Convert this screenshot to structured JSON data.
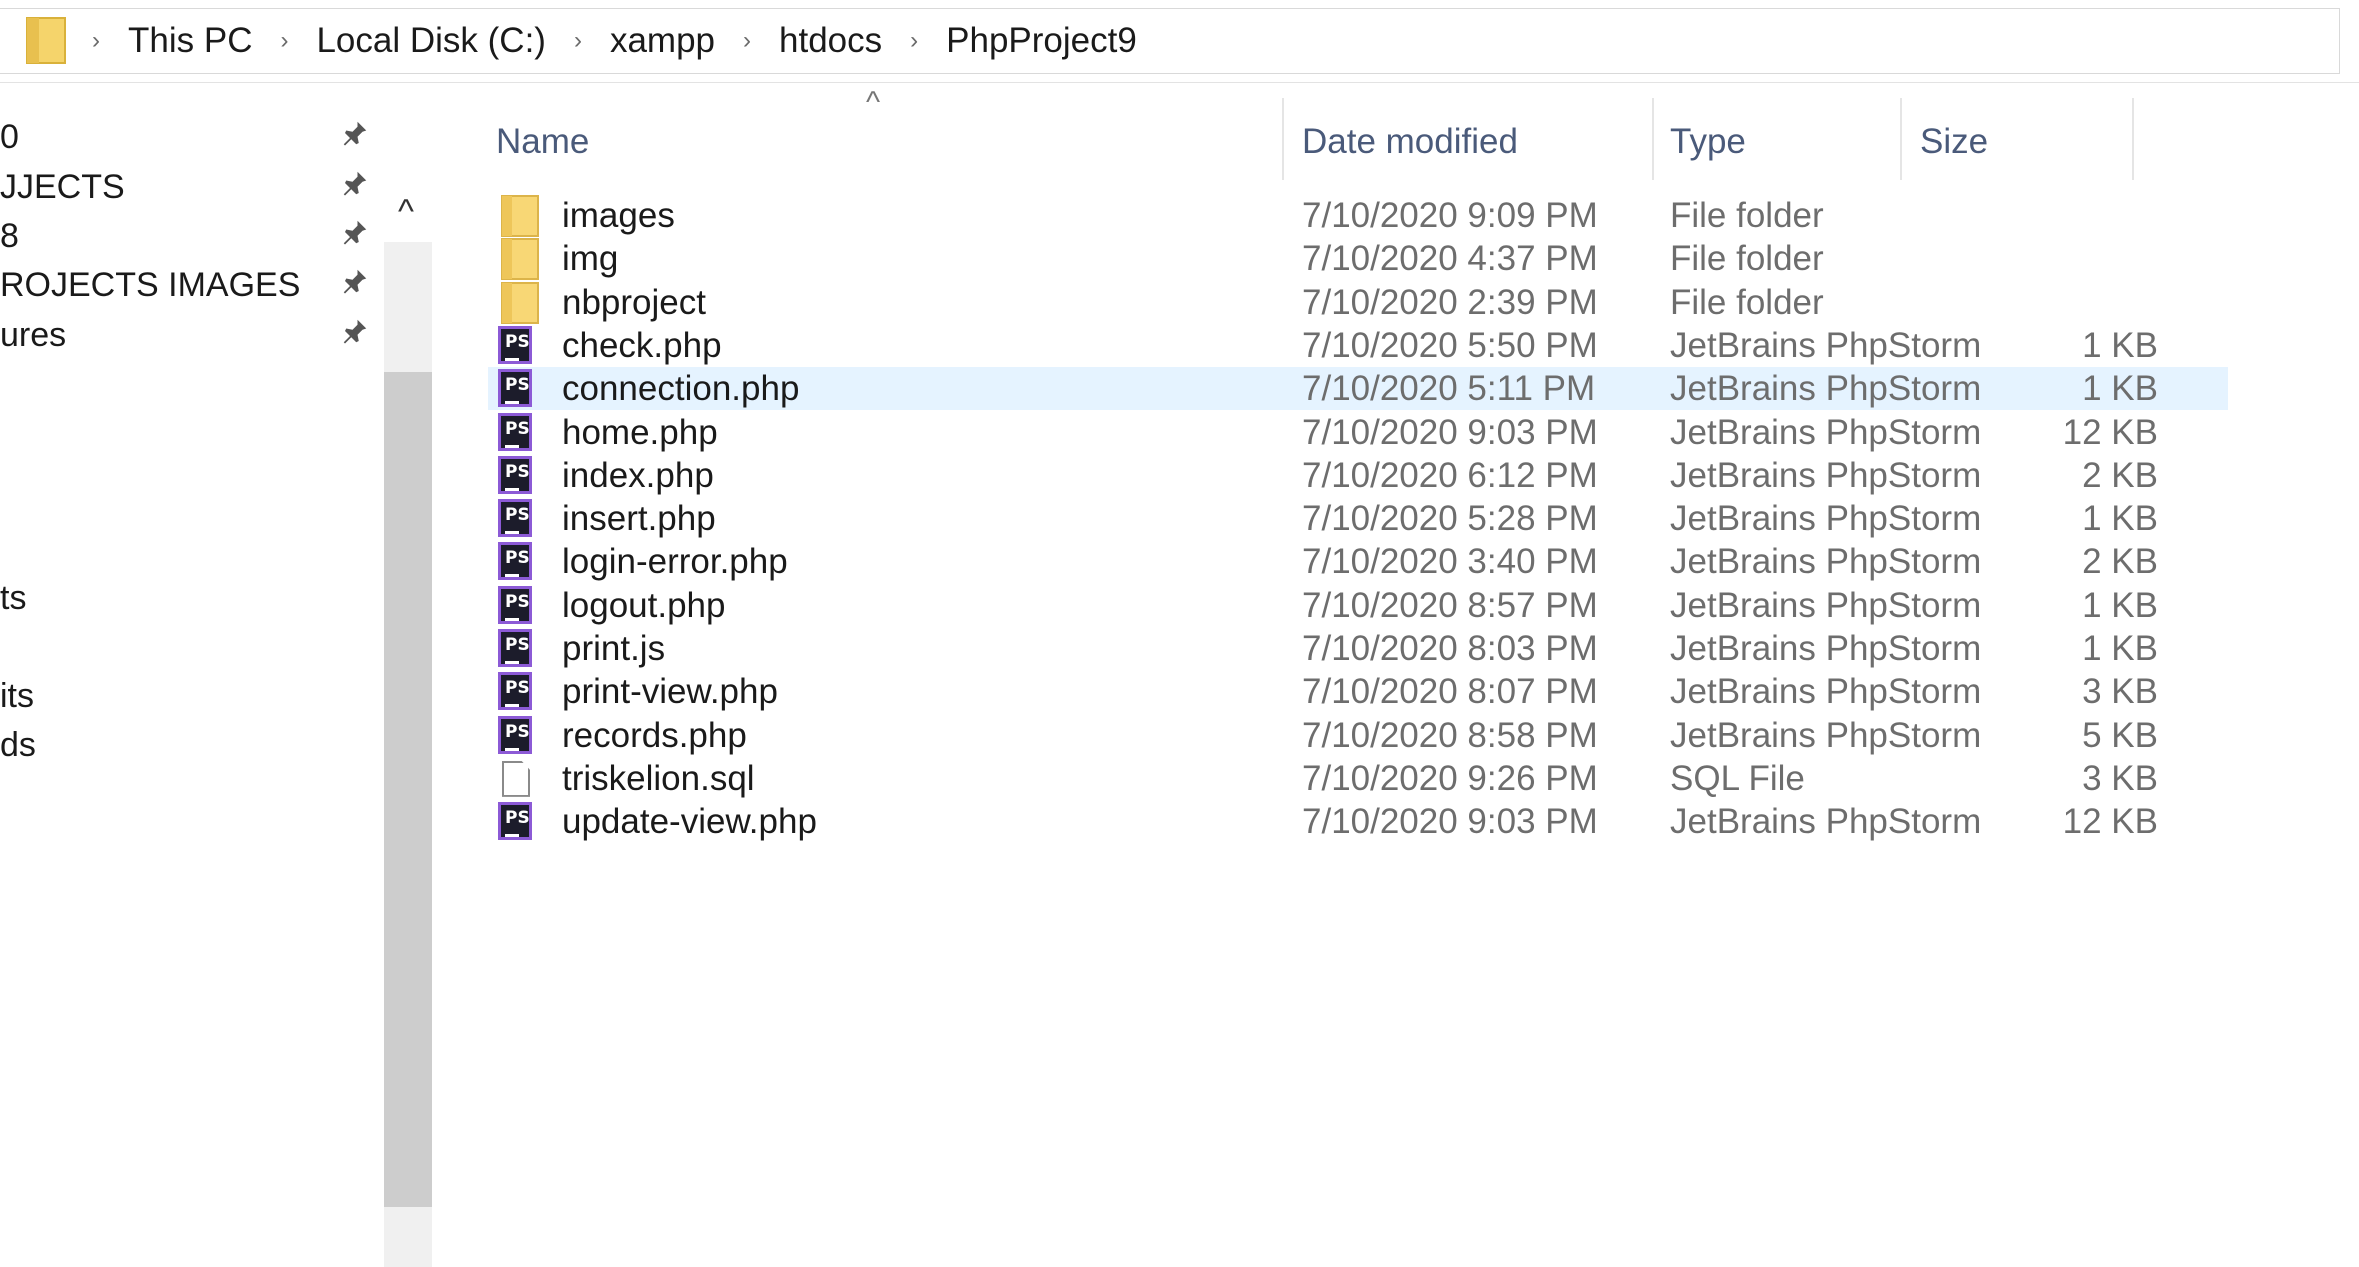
{
  "address_bar": {
    "crumbs": [
      "This PC",
      "Local Disk (C:)",
      "xampp",
      "htdocs",
      "PhpProject9"
    ],
    "separator": "›"
  },
  "nav_pane": {
    "items": [
      {
        "label": "0",
        "pinned": true
      },
      {
        "label": "JJECTS",
        "pinned": true
      },
      {
        "label": "8",
        "pinned": true
      },
      {
        "label": "ROJECTS IMAGES",
        "pinned": true
      },
      {
        "label": "ures",
        "pinned": true
      },
      {
        "label": "ts",
        "pinned": false
      },
      {
        "label": "its",
        "pinned": false
      },
      {
        "label": "ds",
        "pinned": false
      }
    ],
    "pin_glyph": "📌",
    "scroll_up_glyph": "^"
  },
  "file_list": {
    "columns": {
      "name": "Name",
      "date": "Date modified",
      "type": "Type",
      "size": "Size"
    },
    "sort_caret": "^",
    "selected_color": "#e5f3ff",
    "rows": [
      {
        "name": "images",
        "date": "7/10/2020 9:09 PM",
        "type": "File folder",
        "size": "",
        "icon": "folder-icon"
      },
      {
        "name": "img",
        "date": "7/10/2020 4:37 PM",
        "type": "File folder",
        "size": "",
        "icon": "folder-icon"
      },
      {
        "name": "nbproject",
        "date": "7/10/2020 2:39 PM",
        "type": "File folder",
        "size": "",
        "icon": "folder-icon"
      },
      {
        "name": "check.php",
        "date": "7/10/2020 5:50 PM",
        "type": "JetBrains PhpStorm",
        "size": "1 KB",
        "icon": "phpstorm-icon"
      },
      {
        "name": "connection.php",
        "date": "7/10/2020 5:11 PM",
        "type": "JetBrains PhpStorm",
        "size": "1 KB",
        "icon": "phpstorm-icon",
        "selected": true
      },
      {
        "name": "home.php",
        "date": "7/10/2020 9:03 PM",
        "type": "JetBrains PhpStorm",
        "size": "12 KB",
        "icon": "phpstorm-icon"
      },
      {
        "name": "index.php",
        "date": "7/10/2020 6:12 PM",
        "type": "JetBrains PhpStorm",
        "size": "2 KB",
        "icon": "phpstorm-icon"
      },
      {
        "name": "insert.php",
        "date": "7/10/2020 5:28 PM",
        "type": "JetBrains PhpStorm",
        "size": "1 KB",
        "icon": "phpstorm-icon"
      },
      {
        "name": "login-error.php",
        "date": "7/10/2020 3:40 PM",
        "type": "JetBrains PhpStorm",
        "size": "2 KB",
        "icon": "phpstorm-icon"
      },
      {
        "name": "logout.php",
        "date": "7/10/2020 8:57 PM",
        "type": "JetBrains PhpStorm",
        "size": "1 KB",
        "icon": "phpstorm-icon"
      },
      {
        "name": "print.js",
        "date": "7/10/2020 8:03 PM",
        "type": "JetBrains PhpStorm",
        "size": "1 KB",
        "icon": "phpstorm-icon"
      },
      {
        "name": "print-view.php",
        "date": "7/10/2020 8:07 PM",
        "type": "JetBrains PhpStorm",
        "size": "3 KB",
        "icon": "phpstorm-icon"
      },
      {
        "name": "records.php",
        "date": "7/10/2020 8:58 PM",
        "type": "JetBrains PhpStorm",
        "size": "5 KB",
        "icon": "phpstorm-icon"
      },
      {
        "name": "triskelion.sql",
        "date": "7/10/2020 9:26 PM",
        "type": "SQL File",
        "size": "3 KB",
        "icon": "file-icon"
      },
      {
        "name": "update-view.php",
        "date": "7/10/2020 9:03 PM",
        "type": "JetBrains PhpStorm",
        "size": "12 KB",
        "icon": "phpstorm-icon"
      }
    ]
  }
}
